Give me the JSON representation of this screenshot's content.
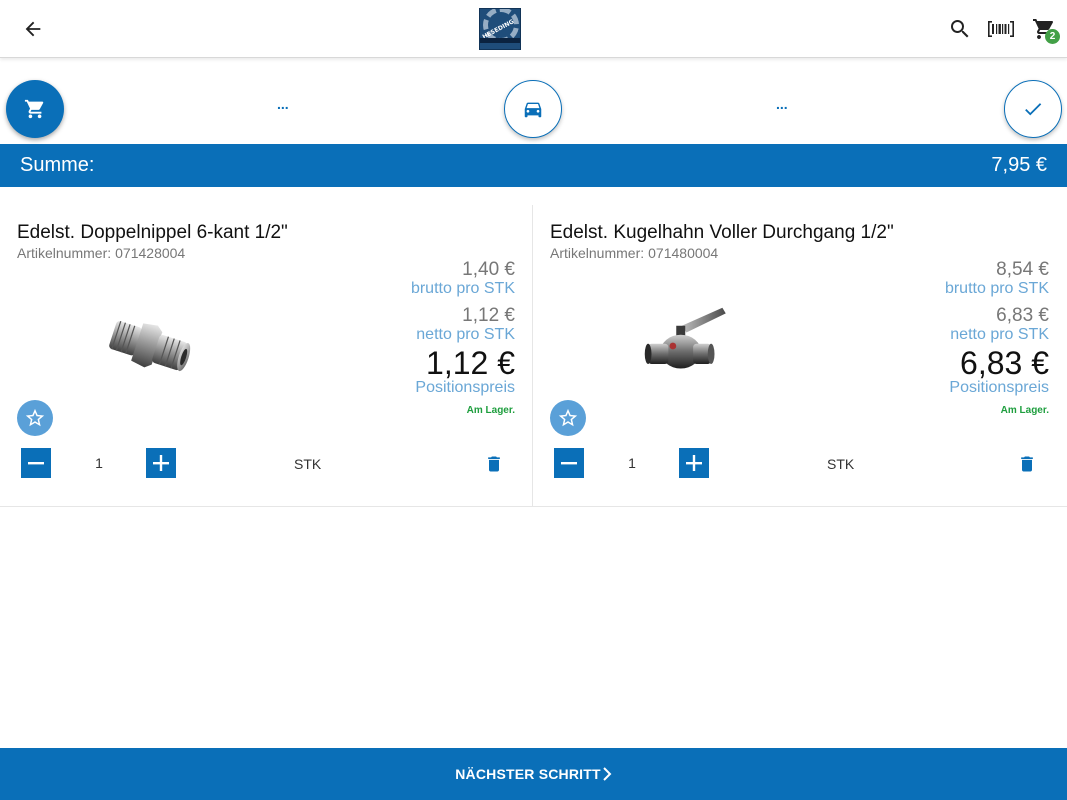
{
  "header": {
    "back_icon": "arrow-left-icon",
    "logo_text": "HESEDING",
    "search_icon": "search-icon",
    "barcode_icon": "barcode-icon",
    "cart_icon": "cart-icon",
    "cart_count": "2"
  },
  "stepper": {
    "dots_1": "...",
    "dots_2": "...",
    "steps": [
      "cart-icon",
      "car-icon",
      "check-icon"
    ]
  },
  "summary": {
    "label": "Summe:",
    "value": "7,95 €"
  },
  "products": [
    {
      "name": "Edelst. Doppelnippel 6-kant 1/2\"",
      "article_label": "Artikelnummer:",
      "article_number": "071428004",
      "gross_price": "1,40 €",
      "gross_label": "brutto pro STK",
      "net_price": "1,12 €",
      "net_label": "netto pro STK",
      "position_price": "1,12 €",
      "position_label": "Positionspreis",
      "stock": "Am Lager.",
      "quantity": "1",
      "unit": "STK"
    },
    {
      "name": "Edelst. Kugelhahn Voller Durchgang 1/2\"",
      "article_label": "Artikelnummer:",
      "article_number": "071480004",
      "gross_price": "8,54 €",
      "gross_label": "brutto pro STK",
      "net_price": "6,83 €",
      "net_label": "netto pro STK",
      "position_price": "6,83 €",
      "position_label": "Positionspreis",
      "stock": "Am Lager.",
      "quantity": "1",
      "unit": "STK"
    }
  ],
  "footer": {
    "next_label": "NÄCHSTER SCHRITT"
  },
  "colors": {
    "primary": "#0a6fb8",
    "light_blue": "#6aa7d6",
    "stock_green": "#1e9e3e",
    "badge_green": "#43a047"
  }
}
